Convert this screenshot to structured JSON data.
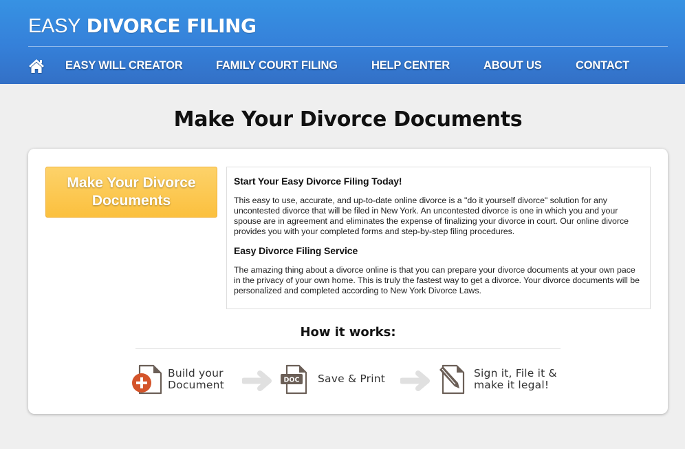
{
  "header": {
    "logo_light": "EASY",
    "logo_bold": "DIVORCE FILING",
    "home_icon": "home-icon",
    "nav": [
      {
        "label": "EASY WILL CREATOR"
      },
      {
        "label": "FAMILY COURT FILING"
      },
      {
        "label": "HELP CENTER"
      },
      {
        "label": "ABOUT US"
      },
      {
        "label": "CONTACT"
      }
    ]
  },
  "page": {
    "title": "Make Your Divorce Documents"
  },
  "card": {
    "cta_button": "Make Your Divorce Documents",
    "info": {
      "heading1": "Start Your Easy Divorce Filing Today!",
      "paragraph1": "This easy to use, accurate, and up-to-date online divorce is a \"do it yourself divorce\" solution for any uncontested divorce that will be filed in New York. An uncontested divorce is one in which you and your spouse are in agreement and eliminates the expense of finalizing your divorce in court. Our online divorce provides you with your completed forms and step-by-step filing procedures.",
      "heading2": "Easy Divorce Filing Service",
      "paragraph2": "The amazing thing about a divorce online is that you can prepare your divorce documents at your own pace in the privacy of your own home. This is truly the fastest way to get a divorce. Your divorce documents will be personalized and completed according to New York Divorce Laws."
    },
    "how_it_works": {
      "title": "How it works:",
      "steps": [
        {
          "line1": "Build your",
          "line2": "Document",
          "icon": "add-document-icon"
        },
        {
          "line1": "Save & Print",
          "line2": "",
          "icon": "doc-file-icon",
          "badge": "DOC"
        },
        {
          "line1": "Sign it, File it &",
          "line2": "make it legal!",
          "icon": "sign-document-icon"
        }
      ],
      "arrow_icon": "arrow-right-icon"
    }
  },
  "colors": {
    "header_blue": "#3580d9",
    "cta_orange": "#fbc03e",
    "icon_red": "#d4542a",
    "icon_brown": "#6b5f57",
    "arrow_gray": "#e0e0e0"
  }
}
